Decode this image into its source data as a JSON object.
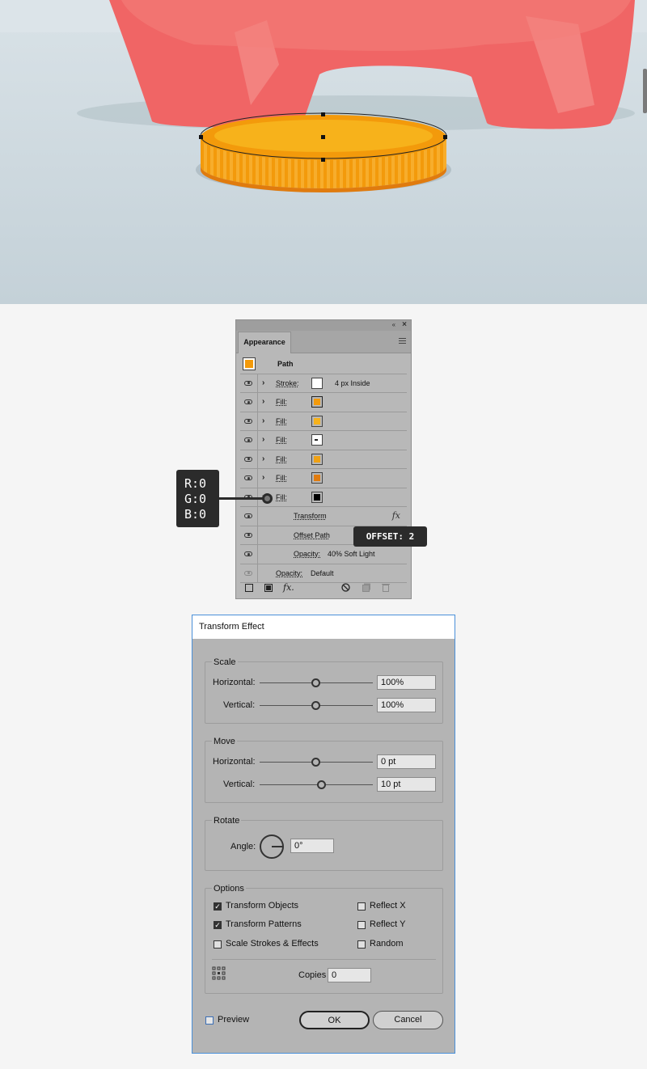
{
  "appearance_panel": {
    "tab_label": "Appearance",
    "collapse_glyph": "‹‹",
    "close_glyph": "×",
    "path_row": {
      "label": "Path",
      "swatch_color": "#f39a0b"
    },
    "rows": [
      {
        "kind": "stroke",
        "label": "Stroke:",
        "swatch_color": "#ffffff",
        "value": "4 px  Inside",
        "expandable": true,
        "visible": true
      },
      {
        "kind": "fill",
        "label": "Fill:",
        "swatch_color": "#f39a0b",
        "value": "",
        "expandable": true,
        "visible": true,
        "selected_border": true
      },
      {
        "kind": "fill",
        "label": "Fill:",
        "swatch_color": "#f7b21b",
        "value": "",
        "expandable": true,
        "visible": true
      },
      {
        "kind": "fill",
        "label": "Fill:",
        "swatch_color": "#ffffff",
        "value": "",
        "expandable": true,
        "visible": true,
        "pattern": true
      },
      {
        "kind": "fill",
        "label": "Fill:",
        "swatch_color": "#f0a114",
        "value": "",
        "expandable": true,
        "visible": true
      },
      {
        "kind": "fill",
        "label": "Fill:",
        "swatch_color": "#e07b0e",
        "value": "",
        "expandable": true,
        "visible": true
      },
      {
        "kind": "fill",
        "label": "Fill:",
        "swatch_color": "#000000",
        "value": "",
        "expandable": true,
        "visible": true
      },
      {
        "kind": "effect",
        "label": "Transform",
        "value": "",
        "fx": "fx",
        "visible": true
      },
      {
        "kind": "effect",
        "label": "Offset Path",
        "value": "",
        "visible": true
      },
      {
        "kind": "effect",
        "label": "Opacity:",
        "value": "40% Soft Light",
        "visible": true
      },
      {
        "kind": "opacity",
        "label": "Opacity:",
        "value": "Default",
        "visible": false
      }
    ],
    "footer_fx": "fx."
  },
  "callouts": {
    "rgb": [
      "R:0",
      "G:0",
      "B:0"
    ],
    "offset": "OFFSET: 2"
  },
  "dialog": {
    "title": "Transform Effect",
    "scale": {
      "title": "Scale",
      "horizontal_label": "Horizontal:",
      "horizontal_value": "100%",
      "vertical_label": "Vertical:",
      "vertical_value": "100%"
    },
    "move": {
      "title": "Move",
      "horizontal_label": "Horizontal:",
      "horizontal_value": "0 pt",
      "vertical_label": "Vertical:",
      "vertical_value": "10 pt"
    },
    "rotate": {
      "title": "Rotate",
      "angle_label": "Angle:",
      "angle_value": "0°"
    },
    "options": {
      "title": "Options",
      "transform_objects": {
        "label": "Transform Objects",
        "checked": true
      },
      "transform_patterns": {
        "label": "Transform Patterns",
        "checked": true
      },
      "scale_strokes": {
        "label": "Scale Strokes & Effects",
        "checked": false
      },
      "reflect_x": {
        "label": "Reflect X",
        "checked": false
      },
      "reflect_y": {
        "label": "Reflect Y",
        "checked": false
      },
      "random": {
        "label": "Random",
        "checked": false
      },
      "copies_label": "Copies",
      "copies_value": "0"
    },
    "preview": {
      "label": "Preview",
      "checked": false
    },
    "ok_label": "OK",
    "cancel_label": "Cancel"
  },
  "colors": {
    "coin_orange": "#f39a0b",
    "coin_top": "#f7b21b",
    "pig_pink": "#f06565",
    "background": "#c9d5dc",
    "dialog_border": "#4a90d9",
    "callout_bg": "#2b2b2b"
  }
}
